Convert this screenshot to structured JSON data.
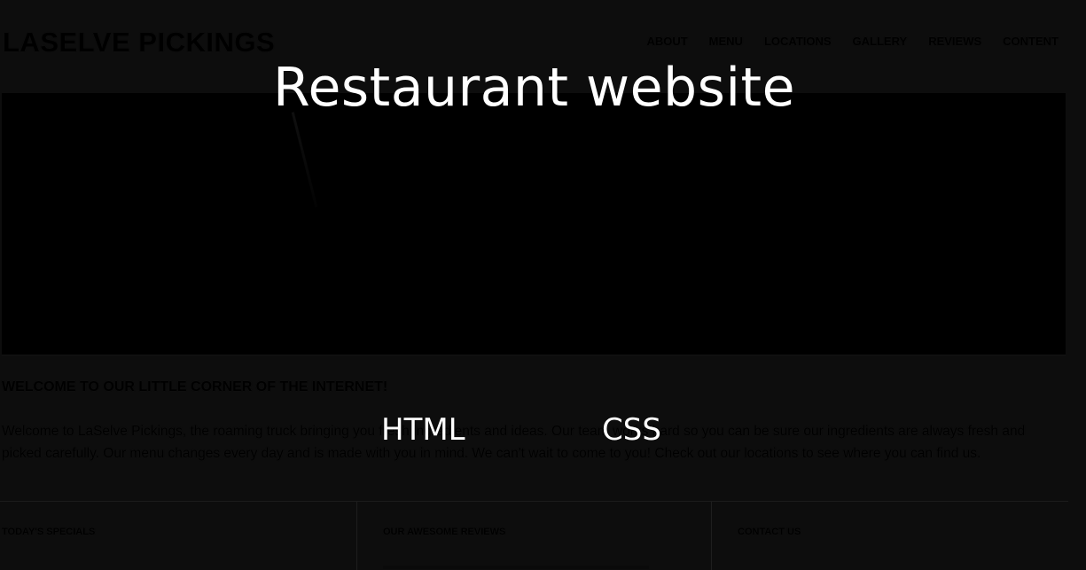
{
  "site": {
    "logo": "LASELVE PICKINGS",
    "nav": [
      "ABOUT",
      "MENU",
      "LOCATIONS",
      "GALLERY",
      "REVIEWS",
      "CONTENT"
    ],
    "welcome_title": "WELCOME TO OUR LITTLE CORNER OF THE INTERNET!",
    "welcome_text": "Welcome to LaSelve Pickings, the roaming truck bringing you fresh ingredients and ideas. Our team works hard so you can be sure our ingredients are always fresh and picked carefully. Our menu changes every day and is made with you in mind. We can't wait to come to you! Check out our locations to see where you can find us.",
    "columns": [
      {
        "title": "TODAY'S SPECIALS"
      },
      {
        "title": "OUR AWESOME REVIEWS"
      },
      {
        "title": "CONTACT US"
      }
    ]
  },
  "overlay": {
    "title": "Restaurant website",
    "tags": [
      "HTML",
      "CSS"
    ]
  },
  "colors": {
    "background": "#0d0d0d",
    "hero": "#000000",
    "overlay_text": "#ffffff"
  }
}
